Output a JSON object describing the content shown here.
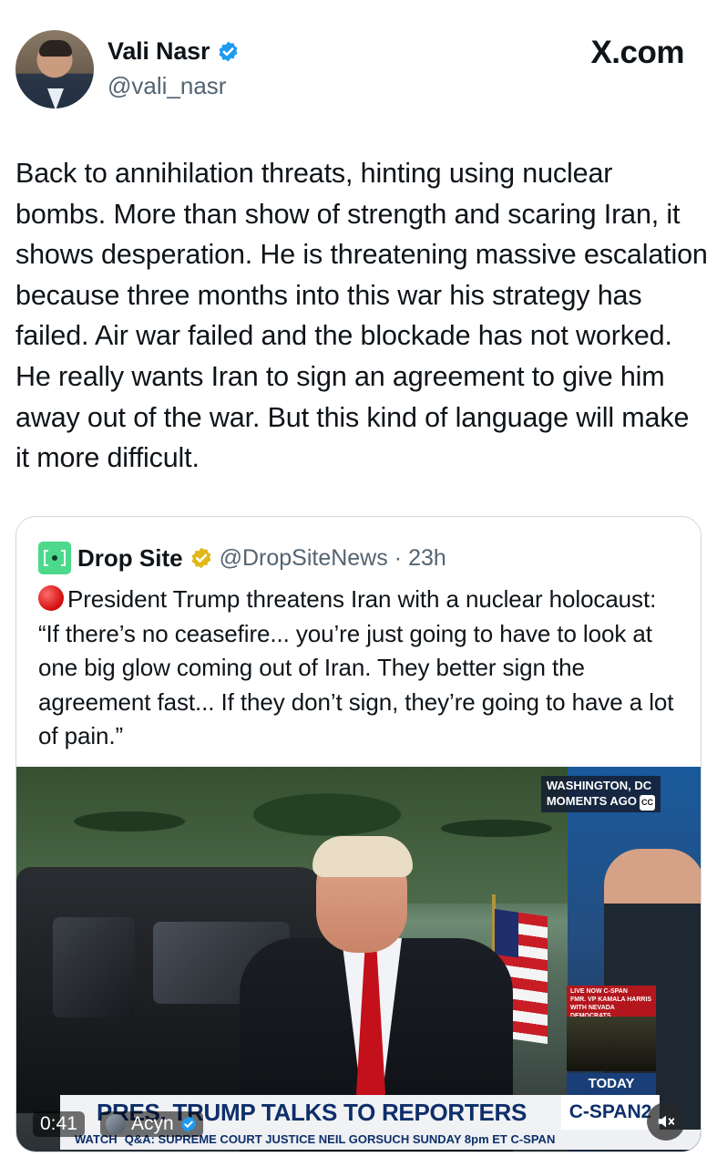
{
  "site": "X.com",
  "author": {
    "name": "Vali Nasr",
    "handle": "@vali_nasr"
  },
  "tweet": {
    "text": "Back to annihilation threats, hinting using nuclear bombs. More than show of strength and scaring Iran, it shows desperation. He is threatening massive escalation because three months into this war his strategy has failed. Air war failed and the blockade has not worked. He really wants Iran to sign an agreement to give him away out of the war. But this kind of language will make it more difficult."
  },
  "quoted": {
    "name": "Drop Site",
    "handle": "@DropSiteNews",
    "separator": "·",
    "time": "23h",
    "text": "President Trump threatens Iran with a nuclear holocaust: “If there’s no ceasefire... you’re just going to have to look at one big glow coming out of Iran. They better sign the agreement fast... If they don’t sign, they’re going to have a lot of pain.”",
    "video": {
      "location_line1": "WASHINGTON, DC",
      "location_line2": "MOMENTS AGO",
      "cc": "CC",
      "live_line1": "LIVE NOW C-SPAN",
      "live_line2": "FMR. VP KAMALA HARRIS",
      "live_line3": "WITH NEVADA DEMOCRATS",
      "today": "TODAY",
      "headline": "PRES. TRUMP TALKS TO REPORTERS",
      "network": "C-SPAN2",
      "ticker_watch": "WATCH",
      "ticker": "Q&A: SUPREME COURT JUSTICE NEIL GORSUCH SUNDAY 8pm ET C-SPAN",
      "duration": "0:41",
      "uploader": "Acyn"
    }
  },
  "colors": {
    "verified_blue": "#1d9bf0",
    "verified_gold": "#e2b719",
    "muted_text": "#536471",
    "dropsite_green": "#4cd98c"
  }
}
